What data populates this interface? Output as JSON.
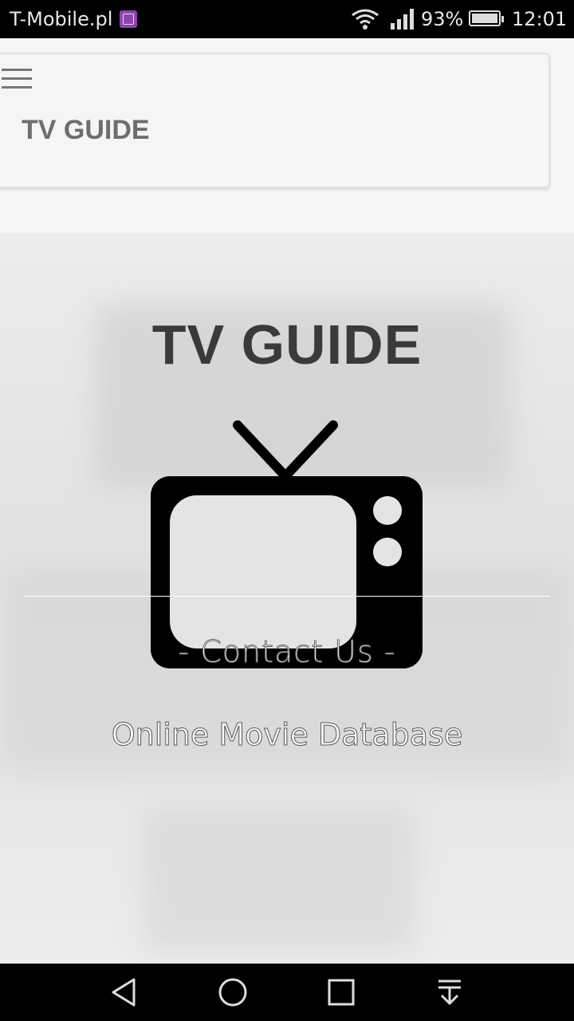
{
  "status_bar": {
    "carrier": "T-Mobile.pl",
    "battery_percent": "93%",
    "time": "12:01"
  },
  "header": {
    "title": "TV GUIDE"
  },
  "hero": {
    "title": "TV GUIDE",
    "contact": "- Contact Us -",
    "subtitle": "Online Movie Database"
  },
  "icons": [
    "gallery-notification-icon",
    "wifi-icon",
    "signal-icon",
    "battery-icon",
    "menu-icon",
    "tv-icon",
    "back-icon",
    "home-icon",
    "recents-icon",
    "notifications-pull-icon"
  ],
  "colors": {
    "status_bar": "#000000",
    "nav_bar": "#000000",
    "header_bg": "#f5f5f5",
    "hero_title": "#3a3a3a"
  }
}
